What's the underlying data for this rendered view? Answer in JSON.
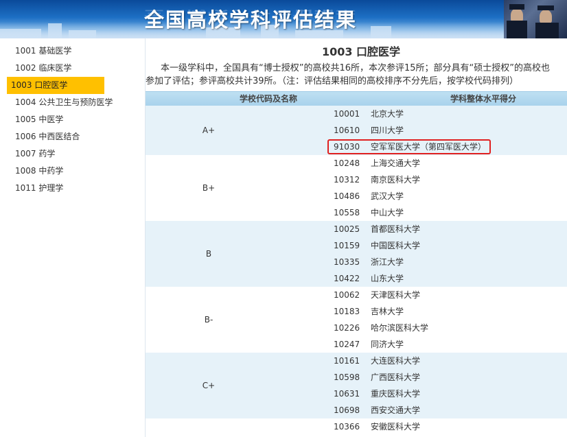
{
  "header": {
    "title": "全国高校学科评估结果"
  },
  "sidebar": {
    "items": [
      {
        "label": "1001 基础医学"
      },
      {
        "label": "1002 临床医学"
      },
      {
        "label": "1003 口腔医学",
        "active": true
      },
      {
        "label": "1004 公共卫生与预防医学"
      },
      {
        "label": "1005 中医学"
      },
      {
        "label": "1006 中西医结合"
      },
      {
        "label": "1007 药学"
      },
      {
        "label": "1008 中药学"
      },
      {
        "label": "1011 护理学"
      }
    ]
  },
  "main": {
    "title": "1003 口腔医学",
    "intro_line1": "本一级学科中，全国具有“博士授权”的高校共16所，本次参评15所；部分具有“硕士授权”的高校也",
    "intro_line2": "参加了评估；参评高校共计39所。（注：评估结果相同的高校排序不分先后，按学校代码排列）",
    "table": {
      "col1": "学校代码及名称",
      "col2": "学科整体水平得分",
      "groups": [
        {
          "grade": "A+",
          "rows": [
            {
              "code": "10001",
              "name": "北京大学"
            },
            {
              "code": "10610",
              "name": "四川大学"
            },
            {
              "code": "91030",
              "name": "空军军医大学（第四军医大学）",
              "highlighted": true
            }
          ]
        },
        {
          "grade": "B+",
          "rows": [
            {
              "code": "10248",
              "name": "上海交通大学"
            },
            {
              "code": "10312",
              "name": "南京医科大学"
            },
            {
              "code": "10486",
              "name": "武汉大学"
            },
            {
              "code": "10558",
              "name": "中山大学"
            }
          ]
        },
        {
          "grade": "B",
          "rows": [
            {
              "code": "10025",
              "name": "首都医科大学"
            },
            {
              "code": "10159",
              "name": "中国医科大学"
            },
            {
              "code": "10335",
              "name": "浙江大学"
            },
            {
              "code": "10422",
              "name": "山东大学"
            }
          ]
        },
        {
          "grade": "B-",
          "rows": [
            {
              "code": "10062",
              "name": "天津医科大学"
            },
            {
              "code": "10183",
              "name": "吉林大学"
            },
            {
              "code": "10226",
              "name": "哈尔滨医科大学"
            },
            {
              "code": "10247",
              "name": "同济大学"
            }
          ]
        },
        {
          "grade": "C+",
          "rows": [
            {
              "code": "10161",
              "name": "大连医科大学"
            },
            {
              "code": "10598",
              "name": "广西医科大学"
            },
            {
              "code": "10631",
              "name": "重庆医科大学"
            },
            {
              "code": "10698",
              "name": "西安交通大学"
            }
          ]
        },
        {
          "grade": "",
          "rows": [
            {
              "code": "10366",
              "name": "安徽医科大学"
            }
          ]
        }
      ]
    }
  },
  "colors": {
    "banner": "#1d6fc4",
    "active_item": "#ffc000",
    "table_header": "#a8d2ec",
    "row_shade": "#e6f2f9",
    "highlight_border": "#e02020"
  }
}
